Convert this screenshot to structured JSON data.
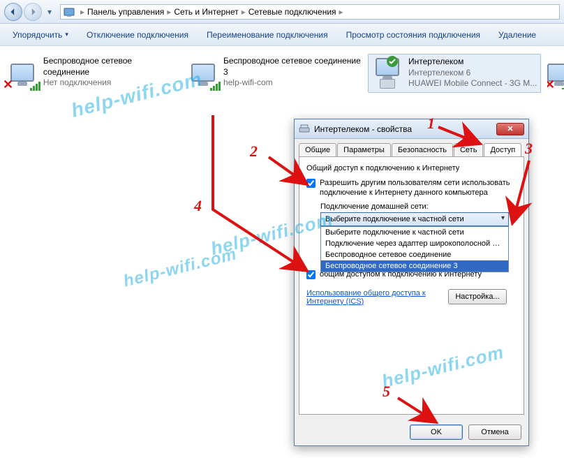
{
  "breadcrumbs": {
    "items": [
      "Панель управления",
      "Сеть и Интернет",
      "Сетевые подключения"
    ]
  },
  "toolbar": {
    "organize": "Упорядочить",
    "disable": "Отключение подключения",
    "rename": "Переименование подключения",
    "status": "Просмотр состояния подключения",
    "delete": "Удаление"
  },
  "connections": {
    "c1": {
      "title": "Беспроводное сетевое соединение",
      "status": "Нет подключения"
    },
    "c2": {
      "title": "Беспроводное сетевое соединение 3",
      "status": "help-wifi-com"
    },
    "c3": {
      "title": "Интертелеком",
      "sub1": "Интертелеком 6",
      "sub2": "HUAWEI Mobile Connect - 3G M..."
    }
  },
  "dialog": {
    "title": "Интертелеком - свойства",
    "tabs": {
      "general": "Общие",
      "params": "Параметры",
      "security": "Безопасность",
      "network": "Сеть",
      "access": "Доступ"
    },
    "groupTitle": "Общий доступ к подключению к Интернету",
    "chk1": "Разрешить другим пользователям сети использовать подключение к Интернету данного компьютера",
    "homeNetLabel": "Подключение домашней сети:",
    "comboSelected": "Выберите подключение к частной сети",
    "options": {
      "o1": "Выберите подключение к частной сети",
      "o2": "Подключение через адаптер широкополосной мобильн",
      "o3": "Беспроводное сетевое соединение",
      "o4": "Беспроводное сетевое соединение 3"
    },
    "chk2partial": "общим доступом к подключению к Интернету",
    "icsLink": "Использование общего доступа к Интернету (ICS)",
    "settingsBtn": "Настройка...",
    "ok": "OK",
    "cancel": "Отмена"
  },
  "annotations": {
    "n1": "1",
    "n2": "2",
    "n3": "3",
    "n4": "4",
    "n5": "5"
  },
  "watermark": "help-wifi.com"
}
